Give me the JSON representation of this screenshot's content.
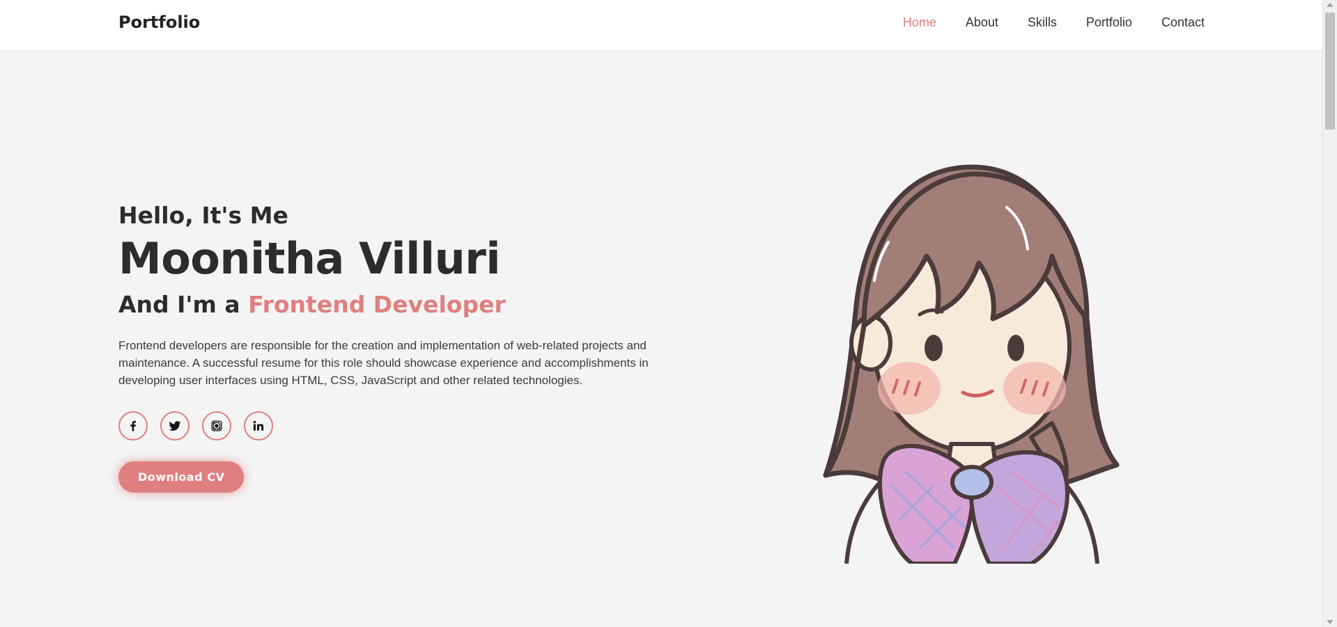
{
  "header": {
    "logo": "Portfolio",
    "nav": [
      {
        "label": "Home",
        "active": true
      },
      {
        "label": "About",
        "active": false
      },
      {
        "label": "Skills",
        "active": false
      },
      {
        "label": "Portfolio",
        "active": false
      },
      {
        "label": "Contact",
        "active": false
      }
    ]
  },
  "hero": {
    "greeting": "Hello, It's Me",
    "name": "Moonitha Villuri",
    "role_prefix": "And I'm a",
    "role_highlight": "Frontend Developer",
    "description": "Frontend developers are responsible for the creation and implementation of web-related projects and maintenance. A successful resume for this role should showcase experience and accomplishments in developing user interfaces using HTML, CSS, JavaScript and other related technologies.",
    "socials": [
      "facebook-icon",
      "twitter-icon",
      "instagram-icon",
      "linkedin-icon"
    ],
    "cta_label": "Download CV"
  },
  "colors": {
    "accent": "#e07f7f",
    "background": "#f4f4f4",
    "header_bg": "#ffffff",
    "text": "#2c2c2c"
  }
}
